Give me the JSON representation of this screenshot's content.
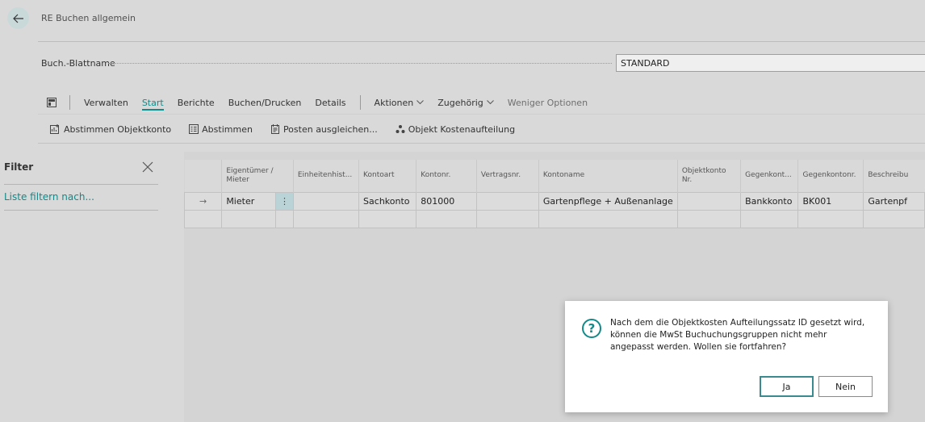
{
  "header": {
    "title": "RE Buchen allgemein"
  },
  "field": {
    "label": "Buch.-Blattname",
    "value": "STANDARD"
  },
  "menu": {
    "items": [
      "Verwalten",
      "Start",
      "Berichte",
      "Buchen/Drucken",
      "Details"
    ],
    "aktionen": "Aktionen",
    "zugehoerig": "Zugehörig",
    "weniger": "Weniger Optionen"
  },
  "toolbar": {
    "abstimmen_objektkonto": "Abstimmen Objektkonto",
    "abstimmen": "Abstimmen",
    "posten": "Posten ausgleichen...",
    "kostenaufteilung": "Objekt Kostenaufteilung"
  },
  "filter": {
    "title": "Filter",
    "link": "Liste filtern nach..."
  },
  "grid": {
    "headers": {
      "eigentuemer": "Eigentümer / Mieter",
      "einheit": "Einheitenhist...",
      "kontoart": "Kontoart",
      "kontonr": "Kontonr.",
      "vertrag": "Vertragsnr.",
      "kontoname": "Kontoname",
      "objektkonto": "Objektkonto Nr.",
      "gegenkontoart": "Gegenkont...",
      "gegenkontonr": "Gegenkontonr.",
      "beschreibung": "Beschreibu"
    },
    "row": {
      "arrow": "→",
      "eigentuemer": "Mieter",
      "more": "⋮",
      "kontoart": "Sachkonto",
      "kontonr": "801000",
      "kontoname": "Gartenpflege  + Außenanlage",
      "gegenkontoart": "Bankkonto",
      "gegenkontonr": "BK001",
      "beschreibung": "Gartenpf"
    }
  },
  "dialog": {
    "message": "Nach dem die Objektkosten Aufteilungssatz ID gesetzt wird, können die MwSt Buchuchungsgruppen nicht mehr angepasst werden. Wollen sie fortfahren?",
    "yes": "Ja",
    "no": "Nein"
  }
}
